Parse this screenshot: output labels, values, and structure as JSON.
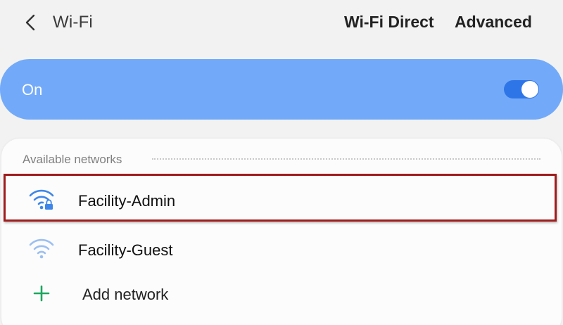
{
  "header": {
    "title": "Wi-Fi",
    "wifi_direct_label": "Wi-Fi Direct",
    "advanced_label": "Advanced"
  },
  "master_switch": {
    "label": "On",
    "enabled": true
  },
  "networks": {
    "section_title": "Available networks",
    "items": [
      {
        "name": "Facility-Admin",
        "secured": true,
        "highlighted": true,
        "icon": "wifi-lock-icon"
      },
      {
        "name": "Facility-Guest",
        "secured": false,
        "highlighted": false,
        "icon": "wifi-icon"
      }
    ],
    "add_label": "Add network"
  },
  "colors": {
    "panel_blue": "#72aaf9",
    "toggle_blue": "#2e75e8",
    "wifi_icon_strong": "#3f86e8",
    "wifi_icon_light": "#9bbff1",
    "add_icon_green": "#1ba75e",
    "highlight_red": "#a01d1d"
  }
}
